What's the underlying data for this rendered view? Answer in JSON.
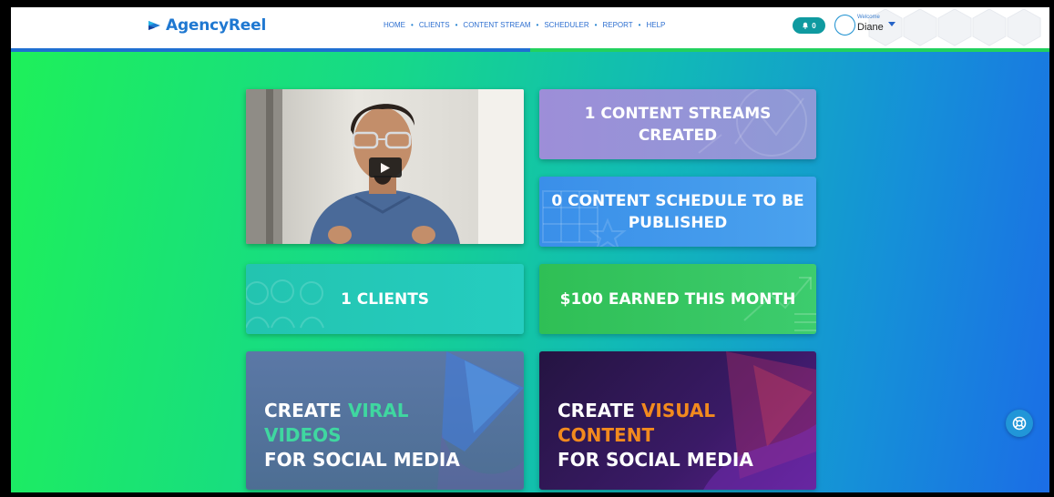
{
  "app": {
    "name": "AgencyReel"
  },
  "nav": {
    "items": [
      {
        "label": "HOME"
      },
      {
        "label": "CLIENTS"
      },
      {
        "label": "CONTENT STREAM"
      },
      {
        "label": "SCHEDULER"
      },
      {
        "label": "REPORT"
      },
      {
        "label": "HELP"
      }
    ]
  },
  "user": {
    "notification_count": "0",
    "welcome": "Welcome",
    "name": "Diane"
  },
  "colors": {
    "brand": "#1f78d1",
    "notif_badge": "#0f9aa0",
    "progress_blue": "#1f6fd1",
    "progress_green": "#22d15e",
    "content_streams_card": "#9a92d8",
    "schedule_card": "#3d93ec",
    "clients_card": "#25c6b6",
    "earnings_card": "#35c05c",
    "viral_card": "#56759c",
    "visual_card": "#2a1a52",
    "accent_green_text": "#3fd7a0",
    "accent_orange_text": "#f28a1e"
  },
  "progress": {
    "fraction": 0.5
  },
  "stats": {
    "content_streams": "1 CONTENT STREAMS CREATED",
    "content_schedule": "0 CONTENT SCHEDULE TO BE PUBLISHED",
    "clients": "1 CLIENTS",
    "earnings": "$100 EARNED THIS MONTH"
  },
  "cta": {
    "viral": {
      "line1_prefix": "CREATE ",
      "line1_accent": "VIRAL",
      "line2_accent": "VIDEOS",
      "line3": "FOR SOCIAL MEDIA"
    },
    "visual": {
      "line1_prefix": "CREATE ",
      "line1_accent": "VISUAL",
      "line2_accent": "CONTENT",
      "line3": "FOR SOCIAL MEDIA"
    }
  },
  "icons": {
    "logo": "agencyreel-logo-icon",
    "bell": "bell-icon",
    "caret": "chevron-down-icon",
    "play": "play-icon",
    "help": "lifebuoy-icon"
  }
}
